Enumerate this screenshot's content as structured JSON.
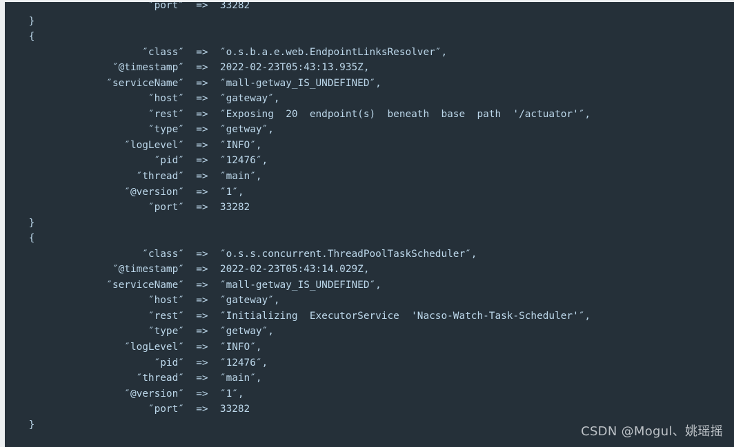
{
  "window": {
    "kind": "terminal-log-console",
    "background_color": "#253039",
    "text_color": "#bcd7ea",
    "gutter_color": "#eceff1",
    "font_size_px": 14.4,
    "line_height_px": 22.55
  },
  "watermark": {
    "text": "CSDN @Mogul、姚瑶摇",
    "color": "#c9ced3"
  },
  "log": {
    "lines": [
      "                        ″port″  =>  33282",
      "    }",
      "    {",
      "                       ″class″  =>  ″o.s.b.a.e.web.EndpointLinksResolver″,",
      "                  ″@timestamp″  =>  2022-02-23T05:43:13.935Z,",
      "                 ″serviceName″  =>  ″mall-getway_IS_UNDEFINED″,",
      "                        ″host″  =>  ″gateway″,",
      "                        ″rest″  =>  ″Exposing  20  endpoint(s)  beneath  base  path  '/actuator'″,",
      "                        ″type″  =>  ″getway″,",
      "                    ″logLevel″  =>  ″INFO″,",
      "                         ″pid″  =>  ″12476″,",
      "                      ″thread″  =>  ″main″,",
      "                    ″@version″  =>  ″1″,",
      "                        ″port″  =>  33282",
      "    }",
      "    {",
      "                       ″class″  =>  ″o.s.s.concurrent.ThreadPoolTaskScheduler″,",
      "                  ″@timestamp″  =>  2022-02-23T05:43:14.029Z,",
      "                 ″serviceName″  =>  ″mall-getway_IS_UNDEFINED″,",
      "                        ″host″  =>  ″gateway″,",
      "                        ″rest″  =>  ″Initializing  ExecutorService  'Nacso-Watch-Task-Scheduler'″,",
      "                        ″type″  =>  ″getway″,",
      "                    ″logLevel″  =>  ″INFO″,",
      "                         ″pid″  =>  ″12476″,",
      "                      ″thread″  =>  ″main″,",
      "                    ″@version″  =>  ″1″,",
      "                        ″port″  =>  33282",
      "    }"
    ],
    "entries": [
      {
        "class": "o.s.b.a.e.web.EndpointLinksResolver",
        "@timestamp": "2022-02-23T05:43:13.935Z",
        "serviceName": "mall-getway_IS_UNDEFINED",
        "host": "gateway",
        "rest": "Exposing  20  endpoint(s)  beneath  base  path  '/actuator'",
        "type": "getway",
        "logLevel": "INFO",
        "pid": "12476",
        "thread": "main",
        "@version": "1",
        "port": "33282"
      },
      {
        "class": "o.s.s.concurrent.ThreadPoolTaskScheduler",
        "@timestamp": "2022-02-23T05:43:14.029Z",
        "serviceName": "mall-getway_IS_UNDEFINED",
        "host": "gateway",
        "rest": "Initializing  ExecutorService  'Nacso-Watch-Task-Scheduler'",
        "type": "getway",
        "logLevel": "INFO",
        "pid": "12476",
        "thread": "main",
        "@version": "1",
        "port": "33282"
      }
    ]
  }
}
